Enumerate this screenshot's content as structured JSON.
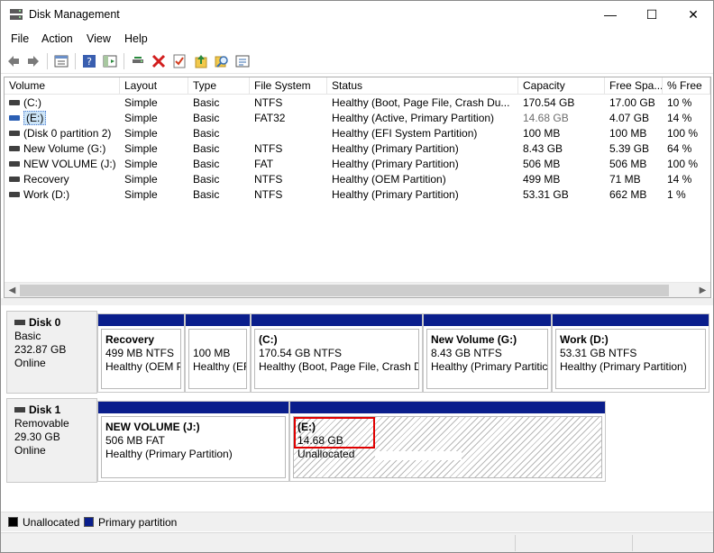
{
  "window": {
    "title": "Disk Management",
    "minimize": "—",
    "maximize": "☐",
    "close": "✕"
  },
  "menu": [
    "File",
    "Action",
    "View",
    "Help"
  ],
  "toolbar": {
    "icons": [
      "back-icon",
      "forward-icon",
      "properties-list-icon",
      "help-icon",
      "show-hide-icon",
      "connect-disk-icon",
      "delete-icon",
      "check-icon",
      "up-arrow-icon",
      "search-icon",
      "settings-icon"
    ]
  },
  "list": {
    "columns": [
      "Volume",
      "Layout",
      "Type",
      "File System",
      "Status",
      "Capacity",
      "Free Spa...",
      "% Free"
    ],
    "rows": [
      {
        "volume": "(C:)",
        "layout": "Simple",
        "type": "Basic",
        "fs": "NTFS",
        "status": "Healthy (Boot, Page File, Crash Du...",
        "capacity": "170.54 GB",
        "free": "17.00 GB",
        "pct": "10 %"
      },
      {
        "volume": "(E:)",
        "layout": "Simple",
        "type": "Basic",
        "fs": "FAT32",
        "status": "Healthy (Active, Primary Partition)",
        "capacity": "14.68 GB",
        "free": "4.07 GB",
        "pct": "14 %"
      },
      {
        "volume": "(Disk 0 partition 2)",
        "layout": "Simple",
        "type": "Basic",
        "fs": "",
        "status": "Healthy (EFI System Partition)",
        "capacity": "100 MB",
        "free": "100 MB",
        "pct": "100 %"
      },
      {
        "volume": "New Volume (G:)",
        "layout": "Simple",
        "type": "Basic",
        "fs": "NTFS",
        "status": "Healthy (Primary Partition)",
        "capacity": "8.43 GB",
        "free": "5.39 GB",
        "pct": "64 %"
      },
      {
        "volume": "NEW VOLUME (J:)",
        "layout": "Simple",
        "type": "Basic",
        "fs": "FAT",
        "status": "Healthy (Primary Partition)",
        "capacity": "506 MB",
        "free": "506 MB",
        "pct": "100 %"
      },
      {
        "volume": "Recovery",
        "layout": "Simple",
        "type": "Basic",
        "fs": "NTFS",
        "status": "Healthy (OEM Partition)",
        "capacity": "499 MB",
        "free": "71 MB",
        "pct": "14 %"
      },
      {
        "volume": "Work (D:)",
        "layout": "Simple",
        "type": "Basic",
        "fs": "NTFS",
        "status": "Healthy (Primary Partition)",
        "capacity": "53.31 GB",
        "free": "662 MB",
        "pct": "1 %"
      }
    ]
  },
  "disks": [
    {
      "name": "Disk 0",
      "kind": "Basic",
      "size": "232.87 GB",
      "state": "Online",
      "partitions": [
        {
          "name": "Recovery",
          "size": "499 MB NTFS",
          "status": "Healthy (OEM P"
        },
        {
          "name": "",
          "size": "100 MB",
          "status": "Healthy (EF"
        },
        {
          "name": "(C:)",
          "size": "170.54 GB NTFS",
          "status": "Healthy (Boot, Page File, Crash Du"
        },
        {
          "name": "New Volume  (G:)",
          "size": "8.43 GB NTFS",
          "status": "Healthy (Primary Partitic"
        },
        {
          "name": "Work  (D:)",
          "size": "53.31 GB NTFS",
          "status": "Healthy (Primary Partition)"
        }
      ]
    },
    {
      "name": "Disk 1",
      "kind": "Removable",
      "size": "29.30 GB",
      "state": "Online",
      "partitions": [
        {
          "name": "NEW VOLUME  (J:)",
          "size": "506 MB FAT",
          "status": "Healthy (Primary Partition)"
        },
        {
          "name": "(E:)",
          "size": "14.68 GB",
          "status": "Unallocated"
        }
      ]
    }
  ],
  "legend": {
    "unallocated": "Unallocated",
    "primary": "Primary partition"
  },
  "colors": {
    "primary_partition": "#0a1e8c",
    "unallocated": "#000000",
    "highlight": "#e00000"
  }
}
